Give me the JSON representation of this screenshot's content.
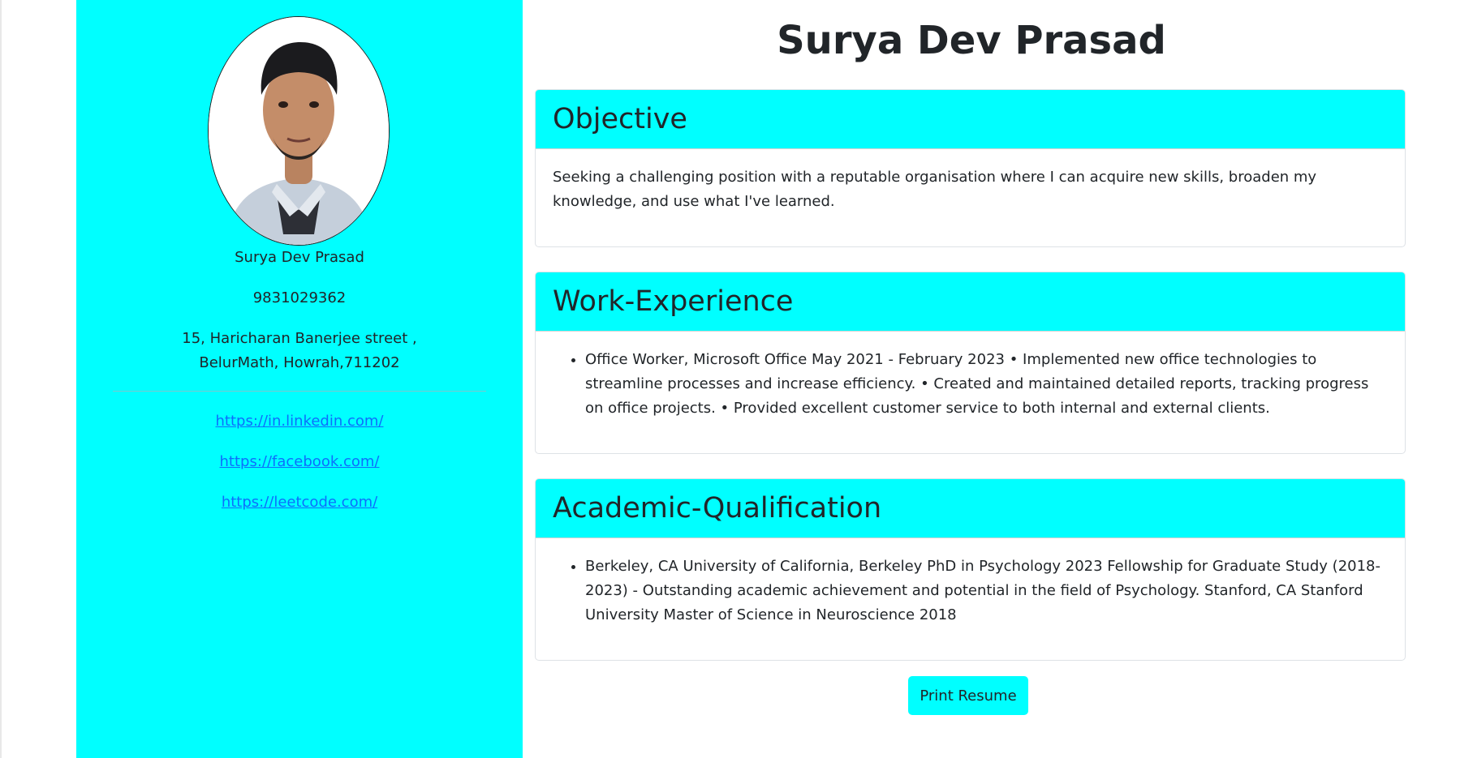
{
  "colors": {
    "accent": "#00ffff",
    "link": "#0d6efd",
    "text": "#212529"
  },
  "sidebar": {
    "photo_icon": "profile-photo",
    "name": "Surya Dev Prasad",
    "phone": "9831029362",
    "address": "15, Haricharan Banerjee street , BelurMath, Howrah,711202",
    "links": [
      "https://in.linkedin.com/",
      "https://facebook.com/",
      "https://leetcode.com/"
    ]
  },
  "main": {
    "title": "Surya Dev Prasad",
    "objective": {
      "heading": "Objective",
      "text": "Seeking a challenging position with a reputable organisation where I can acquire new skills, broaden my knowledge, and use what I've learned."
    },
    "work": {
      "heading": "Work-Experience",
      "items": [
        "Office Worker, Microsoft Office May 2021 - February 2023 • Implemented new office technologies to streamline processes and increase efficiency. • Created and maintained detailed reports, tracking progress on office projects. • Provided excellent customer service to both internal and external clients."
      ]
    },
    "academic": {
      "heading": "Academic-Qualification",
      "items": [
        "Berkeley, CA University of California, Berkeley PhD in Psychology 2023 Fellowship for Graduate Study (2018-2023) - Outstanding academic achievement and potential in the field of Psychology. Stanford, CA Stanford University Master of Science in Neuroscience 2018"
      ]
    },
    "print_label": "Print Resume"
  }
}
